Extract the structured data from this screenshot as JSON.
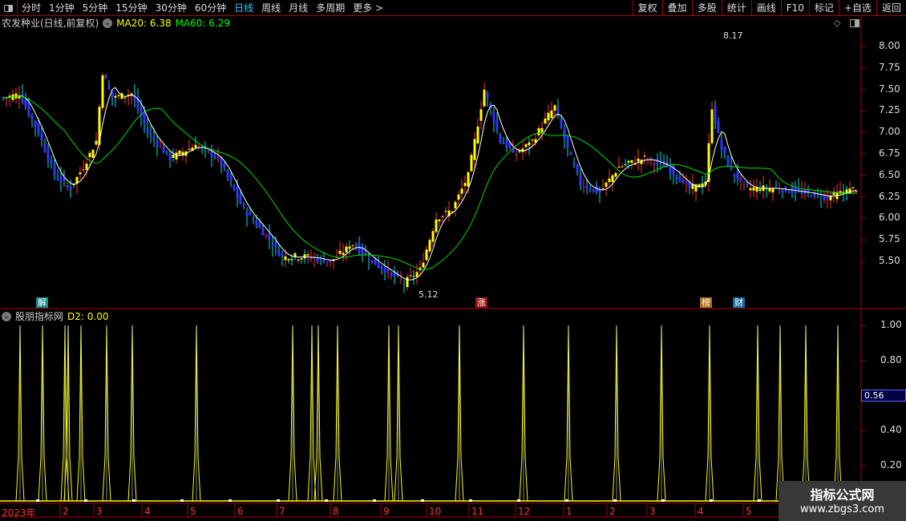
{
  "toolbar": {
    "periods": [
      "分时",
      "1分钟",
      "5分钟",
      "15分钟",
      "30分钟",
      "60分钟",
      "日线",
      "周线",
      "月线",
      "多周期",
      "更多 >"
    ],
    "active": "日线",
    "buttons": [
      "复权",
      "叠加",
      "多股",
      "统计",
      "画线",
      "F10",
      "标记",
      "+自选",
      "返回"
    ]
  },
  "main": {
    "stock_title": "农发种业(日线,前复权)",
    "ma20_label": "MA20: 6.38",
    "ma60_label": "MA60: 6.29",
    "high_label": "8.17",
    "low_label": "5.12",
    "price_ticks": [
      "8.00",
      "7.75",
      "7.50",
      "7.25",
      "7.00",
      "6.75",
      "6.50",
      "6.25",
      "6.00",
      "5.75",
      "5.50"
    ],
    "markers": [
      {
        "text": "解",
        "color": "#1a8a8a"
      },
      {
        "text": "涨",
        "color": "#a01010"
      },
      {
        "text": "榜",
        "color": "#b07020"
      },
      {
        "text": "财",
        "color": "#1a6aa0"
      }
    ]
  },
  "indicator": {
    "title": "股朋指标网",
    "d2_label": "D2: 0.00",
    "ticks": [
      "1.00",
      "0.80",
      "0.56",
      "0.40",
      "0.20"
    ],
    "current_value": "0.56"
  },
  "xaxis": {
    "labels": [
      "2023年",
      "2",
      "3",
      "4",
      "5",
      "6",
      "7",
      "8",
      "9",
      "10",
      "11",
      "12",
      "1",
      "2",
      "3",
      "4",
      "5"
    ]
  },
  "watermark": {
    "line1": "指标公式网",
    "line2": "www.zbgs3.com"
  },
  "chart_data": {
    "type": "candlestick",
    "ylim": [
      5.1,
      8.2
    ],
    "up_color": "#ff3333",
    "down_color": "#00e0e0",
    "close_keypoints": [
      [
        0,
        7.4
      ],
      [
        5,
        7.45
      ],
      [
        11,
        7.0
      ],
      [
        16,
        6.5
      ],
      [
        21,
        6.35
      ],
      [
        25,
        6.6
      ],
      [
        29,
        6.9
      ],
      [
        31,
        7.7
      ],
      [
        34,
        7.4
      ],
      [
        40,
        7.45
      ],
      [
        45,
        7.0
      ],
      [
        52,
        6.7
      ],
      [
        60,
        6.85
      ],
      [
        67,
        6.7
      ],
      [
        75,
        6.1
      ],
      [
        82,
        5.8
      ],
      [
        87,
        5.55
      ],
      [
        95,
        5.55
      ],
      [
        102,
        5.5
      ],
      [
        109,
        5.7
      ],
      [
        115,
        5.5
      ],
      [
        125,
        5.25
      ],
      [
        130,
        5.4
      ],
      [
        135,
        6.0
      ],
      [
        140,
        6.1
      ],
      [
        145,
        6.5
      ],
      [
        150,
        7.5
      ],
      [
        155,
        6.9
      ],
      [
        160,
        6.75
      ],
      [
        165,
        6.9
      ],
      [
        170,
        7.2
      ],
      [
        172,
        7.3
      ],
      [
        176,
        6.8
      ],
      [
        180,
        6.4
      ],
      [
        186,
        6.3
      ],
      [
        192,
        6.6
      ],
      [
        200,
        6.7
      ],
      [
        207,
        6.6
      ],
      [
        214,
        6.35
      ],
      [
        219,
        6.4
      ],
      [
        221,
        7.3
      ],
      [
        224,
        6.8
      ],
      [
        227,
        6.55
      ],
      [
        232,
        6.35
      ],
      [
        240,
        6.35
      ],
      [
        250,
        6.3
      ],
      [
        257,
        6.25
      ],
      [
        266,
        6.35
      ]
    ],
    "indicator_spike_days": [
      3,
      10,
      17,
      18,
      22,
      30,
      38,
      58,
      88,
      94,
      96,
      102,
      118,
      121,
      140,
      160,
      174,
      189,
      203,
      218,
      233,
      240,
      248,
      258
    ]
  }
}
